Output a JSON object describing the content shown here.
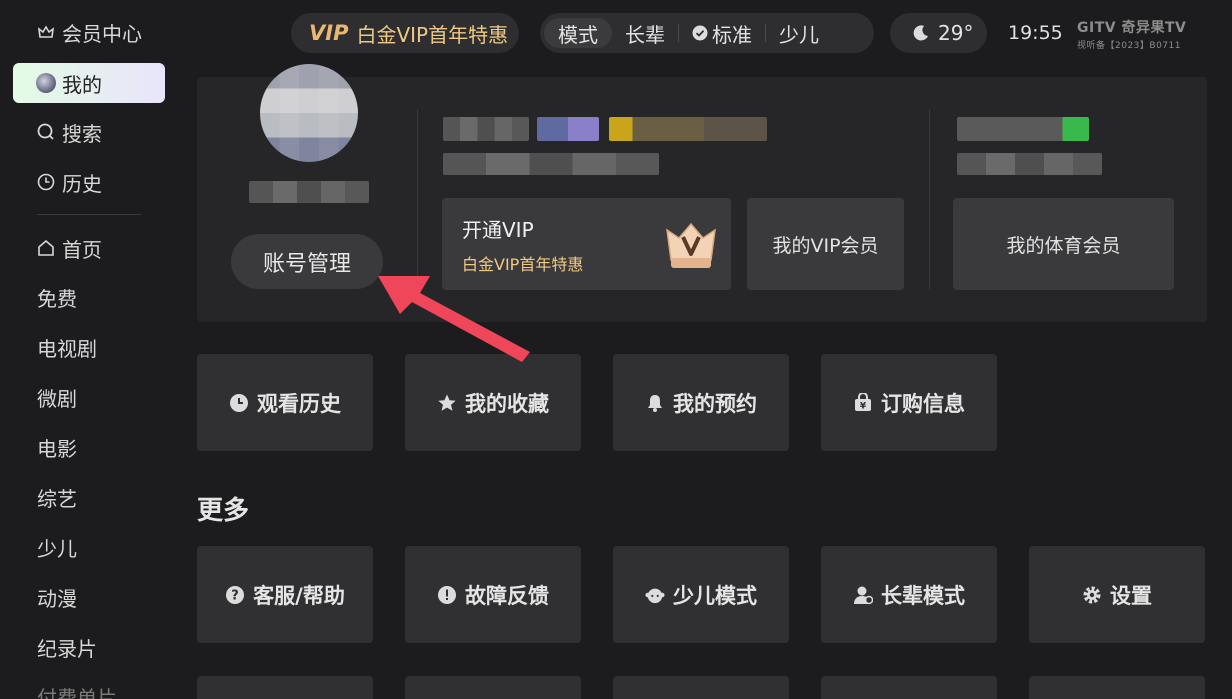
{
  "sidebar": {
    "items": [
      {
        "label": "会员中心",
        "icon": "crown-icon"
      },
      {
        "label": "我的",
        "icon": "avatar-icon"
      },
      {
        "label": "搜索",
        "icon": "search-icon"
      },
      {
        "label": "历史",
        "icon": "clock-icon"
      },
      {
        "label": "首页",
        "icon": "home-icon"
      },
      {
        "label": "免费"
      },
      {
        "label": "电视剧"
      },
      {
        "label": "微剧"
      },
      {
        "label": "电影"
      },
      {
        "label": "综艺"
      },
      {
        "label": "少儿"
      },
      {
        "label": "动漫"
      },
      {
        "label": "纪录片"
      },
      {
        "label": "付费单片"
      }
    ]
  },
  "topbar": {
    "vip_tag": "VIP",
    "vip_promo": "白金VIP首年特惠",
    "modes": [
      "模式",
      "长辈",
      "标准",
      "少儿"
    ],
    "weather": "29°",
    "time": "19:55",
    "brand_line1": "GITV 奇异果TV",
    "brand_line2": "视听备【2023】B0711"
  },
  "profile": {
    "account_button": "账号管理",
    "vip_open_title": "开通VIP",
    "vip_open_subtitle": "白金VIP首年特惠",
    "my_vip": "我的VIP会员",
    "my_sports": "我的体育会员"
  },
  "quick_tiles": [
    {
      "label": "观看历史",
      "icon": "clock-icon"
    },
    {
      "label": "我的收藏",
      "icon": "star-icon"
    },
    {
      "label": "我的预约",
      "icon": "bell-icon"
    },
    {
      "label": "订购信息",
      "icon": "shopping-bag-icon"
    }
  ],
  "more": {
    "title": "更多",
    "tiles": [
      {
        "label": "客服/帮助",
        "icon": "help-icon"
      },
      {
        "label": "故障反馈",
        "icon": "alert-icon"
      },
      {
        "label": "少儿模式",
        "icon": "kid-face-icon"
      },
      {
        "label": "长辈模式",
        "icon": "elder-icon"
      },
      {
        "label": "设置",
        "icon": "gear-icon"
      }
    ]
  },
  "colors": {
    "background": "#1c1c1e",
    "tile": "#303032",
    "vip_gold": "#f0c985",
    "arrow": "#f0465a"
  }
}
